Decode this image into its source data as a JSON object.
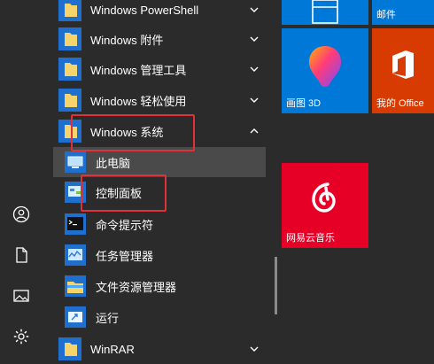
{
  "app_list": {
    "items": [
      {
        "label": "Windows PowerShell",
        "expanded": false
      },
      {
        "label": "Windows 附件",
        "expanded": false
      },
      {
        "label": "Windows 管理工具",
        "expanded": false
      },
      {
        "label": "Windows 轻松使用",
        "expanded": false
      },
      {
        "label": "Windows 系统",
        "expanded": true
      },
      {
        "label": "此电脑",
        "icon": "computer-icon"
      },
      {
        "label": "控制面板",
        "icon": "control-panel-icon"
      },
      {
        "label": "命令提示符",
        "icon": "command-prompt-icon"
      },
      {
        "label": "任务管理器",
        "icon": "task-manager-icon"
      },
      {
        "label": "文件资源管理器",
        "icon": "file-explorer-icon"
      },
      {
        "label": "运行",
        "icon": "run-icon"
      },
      {
        "label": "WinRAR",
        "expanded": false
      }
    ]
  },
  "tiles": [
    {
      "label": "",
      "icon": "calendar-icon"
    },
    {
      "label": "邮件",
      "icon": "mail-icon"
    },
    {
      "label": "画图 3D",
      "icon": "paint-3d-icon"
    },
    {
      "label": "我的 Office",
      "icon": "office-icon"
    },
    {
      "label": "网易云音乐",
      "icon": "netease-music-icon"
    }
  ],
  "rail": {
    "icons": [
      "user-icon",
      "document-icon",
      "pictures-icon",
      "settings-icon"
    ]
  },
  "colors": {
    "background": "#2b2b2b",
    "folder_yellow": "#f6d36b",
    "tile_blue": "#0078d7",
    "office_orange": "#d83b01",
    "netease_red": "#e60026",
    "highlight_box": "#e0303a"
  }
}
